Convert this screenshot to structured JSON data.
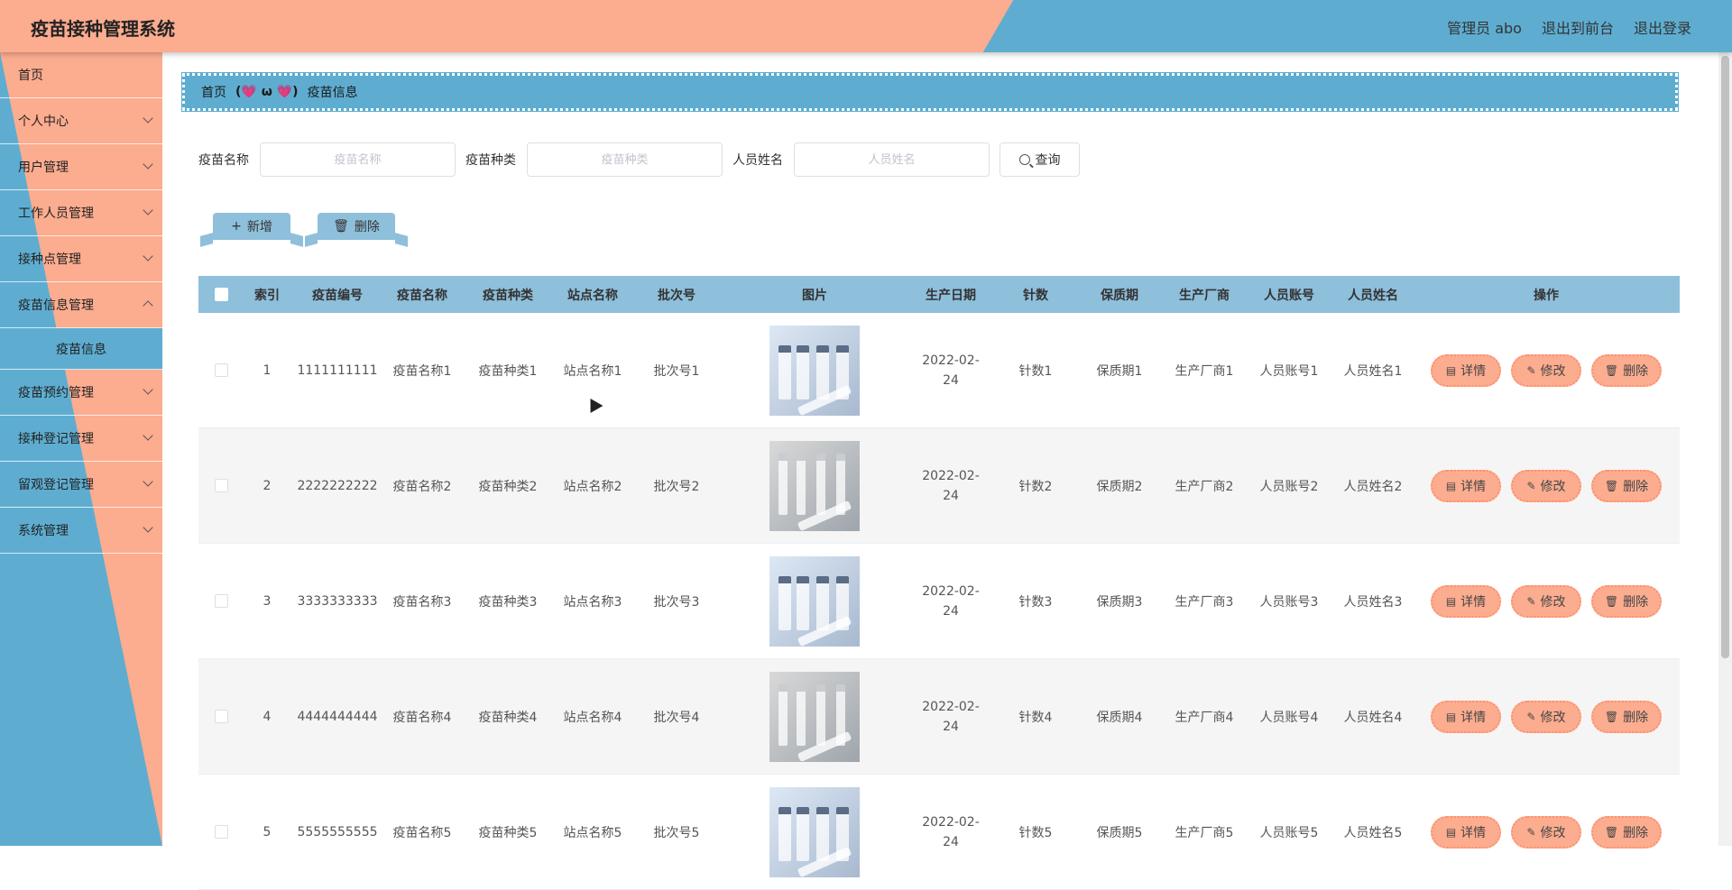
{
  "header": {
    "title": "疫苗接种管理系统",
    "user": "管理员 abo",
    "front_link": "退出到前台",
    "logout_link": "退出登录"
  },
  "sidebar": {
    "items": [
      {
        "label": "首页"
      },
      {
        "label": "个人中心"
      },
      {
        "label": "用户管理"
      },
      {
        "label": "工作人员管理"
      },
      {
        "label": "接种点管理"
      },
      {
        "label": "疫苗信息管理"
      },
      {
        "label": "疫苗预约管理"
      },
      {
        "label": "接种登记管理"
      },
      {
        "label": "留观登记管理"
      },
      {
        "label": "系统管理"
      }
    ],
    "sub_item": "疫苗信息"
  },
  "breadcrumb": {
    "home": "首页",
    "separator": "(💗 ω 💗)",
    "current": "疫苗信息"
  },
  "search": {
    "name_label": "疫苗名称",
    "name_placeholder": "疫苗名称",
    "type_label": "疫苗种类",
    "type_placeholder": "疫苗种类",
    "person_label": "人员姓名",
    "person_placeholder": "人员姓名",
    "query_label": "查询"
  },
  "actions": {
    "add_label": "新增",
    "delete_label": "删除"
  },
  "table": {
    "headers": [
      "索引",
      "疫苗编号",
      "疫苗名称",
      "疫苗种类",
      "站点名称",
      "批次号",
      "图片",
      "生产日期",
      "针数",
      "保质期",
      "生产厂商",
      "人员账号",
      "人员姓名",
      "操作"
    ],
    "rows": [
      {
        "index": "1",
        "code": "1111111111",
        "name": "疫苗名称1",
        "type": "疫苗种类1",
        "site": "站点名称1",
        "batch": "批次号1",
        "date": "2022-02-24",
        "doses": "针数1",
        "shelf": "保质期1",
        "maker": "生产厂商1",
        "account": "人员账号1",
        "person": "人员姓名1"
      },
      {
        "index": "2",
        "code": "2222222222",
        "name": "疫苗名称2",
        "type": "疫苗种类2",
        "site": "站点名称2",
        "batch": "批次号2",
        "date": "2022-02-24",
        "doses": "针数2",
        "shelf": "保质期2",
        "maker": "生产厂商2",
        "account": "人员账号2",
        "person": "人员姓名2"
      },
      {
        "index": "3",
        "code": "3333333333",
        "name": "疫苗名称3",
        "type": "疫苗种类3",
        "site": "站点名称3",
        "batch": "批次号3",
        "date": "2022-02-24",
        "doses": "针数3",
        "shelf": "保质期3",
        "maker": "生产厂商3",
        "account": "人员账号3",
        "person": "人员姓名3"
      },
      {
        "index": "4",
        "code": "4444444444",
        "name": "疫苗名称4",
        "type": "疫苗种类4",
        "site": "站点名称4",
        "batch": "批次号4",
        "date": "2022-02-24",
        "doses": "针数4",
        "shelf": "保质期4",
        "maker": "生产厂商4",
        "account": "人员账号4",
        "person": "人员姓名4"
      },
      {
        "index": "5",
        "code": "5555555555",
        "name": "疫苗名称5",
        "type": "疫苗种类5",
        "site": "站点名称5",
        "batch": "批次号5",
        "date": "2022-02-24",
        "doses": "针数5",
        "shelf": "保质期5",
        "maker": "生产厂商5",
        "account": "人员账号5",
        "person": "人员姓名5"
      }
    ],
    "ops": {
      "detail": "详情",
      "edit": "修改",
      "delete": "删除"
    }
  },
  "colors": {
    "header_left": "#fcac8f",
    "header_right": "#5eadd1",
    "table_head": "#8ebfdb",
    "op_button": "#fcac8f"
  }
}
